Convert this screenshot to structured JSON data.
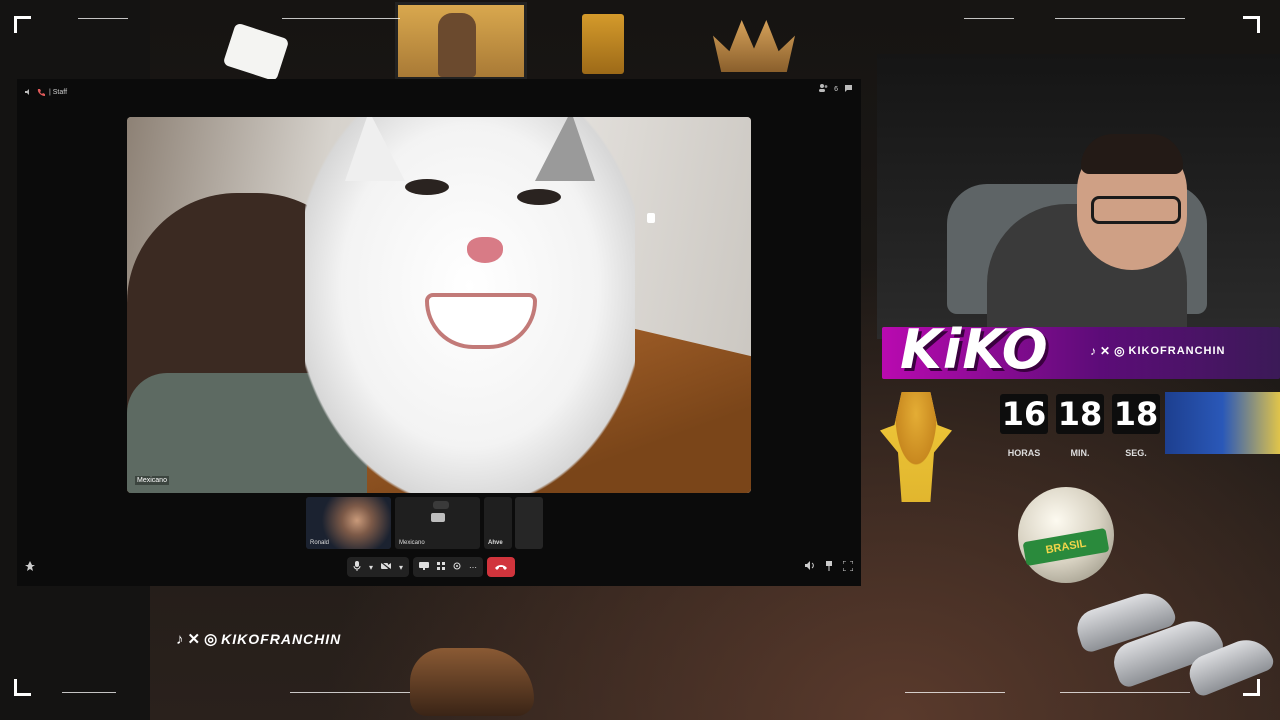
{
  "call": {
    "channel_label": "| Staff",
    "participant_count": "6",
    "main_speaker": "Mexicano",
    "thumbnails": [
      {
        "name": "Ronald"
      },
      {
        "name": "Mexicano"
      },
      {
        "name": "Ahve"
      }
    ]
  },
  "overlay": {
    "streamer_name": "KiKO",
    "social_handle": "KIKOFRANCHIN",
    "social_icons": [
      "tiktok-icon",
      "x-icon",
      "instagram-icon"
    ],
    "timer": {
      "hours": "16",
      "minutes": "18",
      "seconds": "18",
      "hours_label": "HORAS",
      "minutes_label": "MIN.",
      "seconds_label": "SEG."
    },
    "ball_text": "BRASIL",
    "accent_color": "#b90ab0"
  }
}
